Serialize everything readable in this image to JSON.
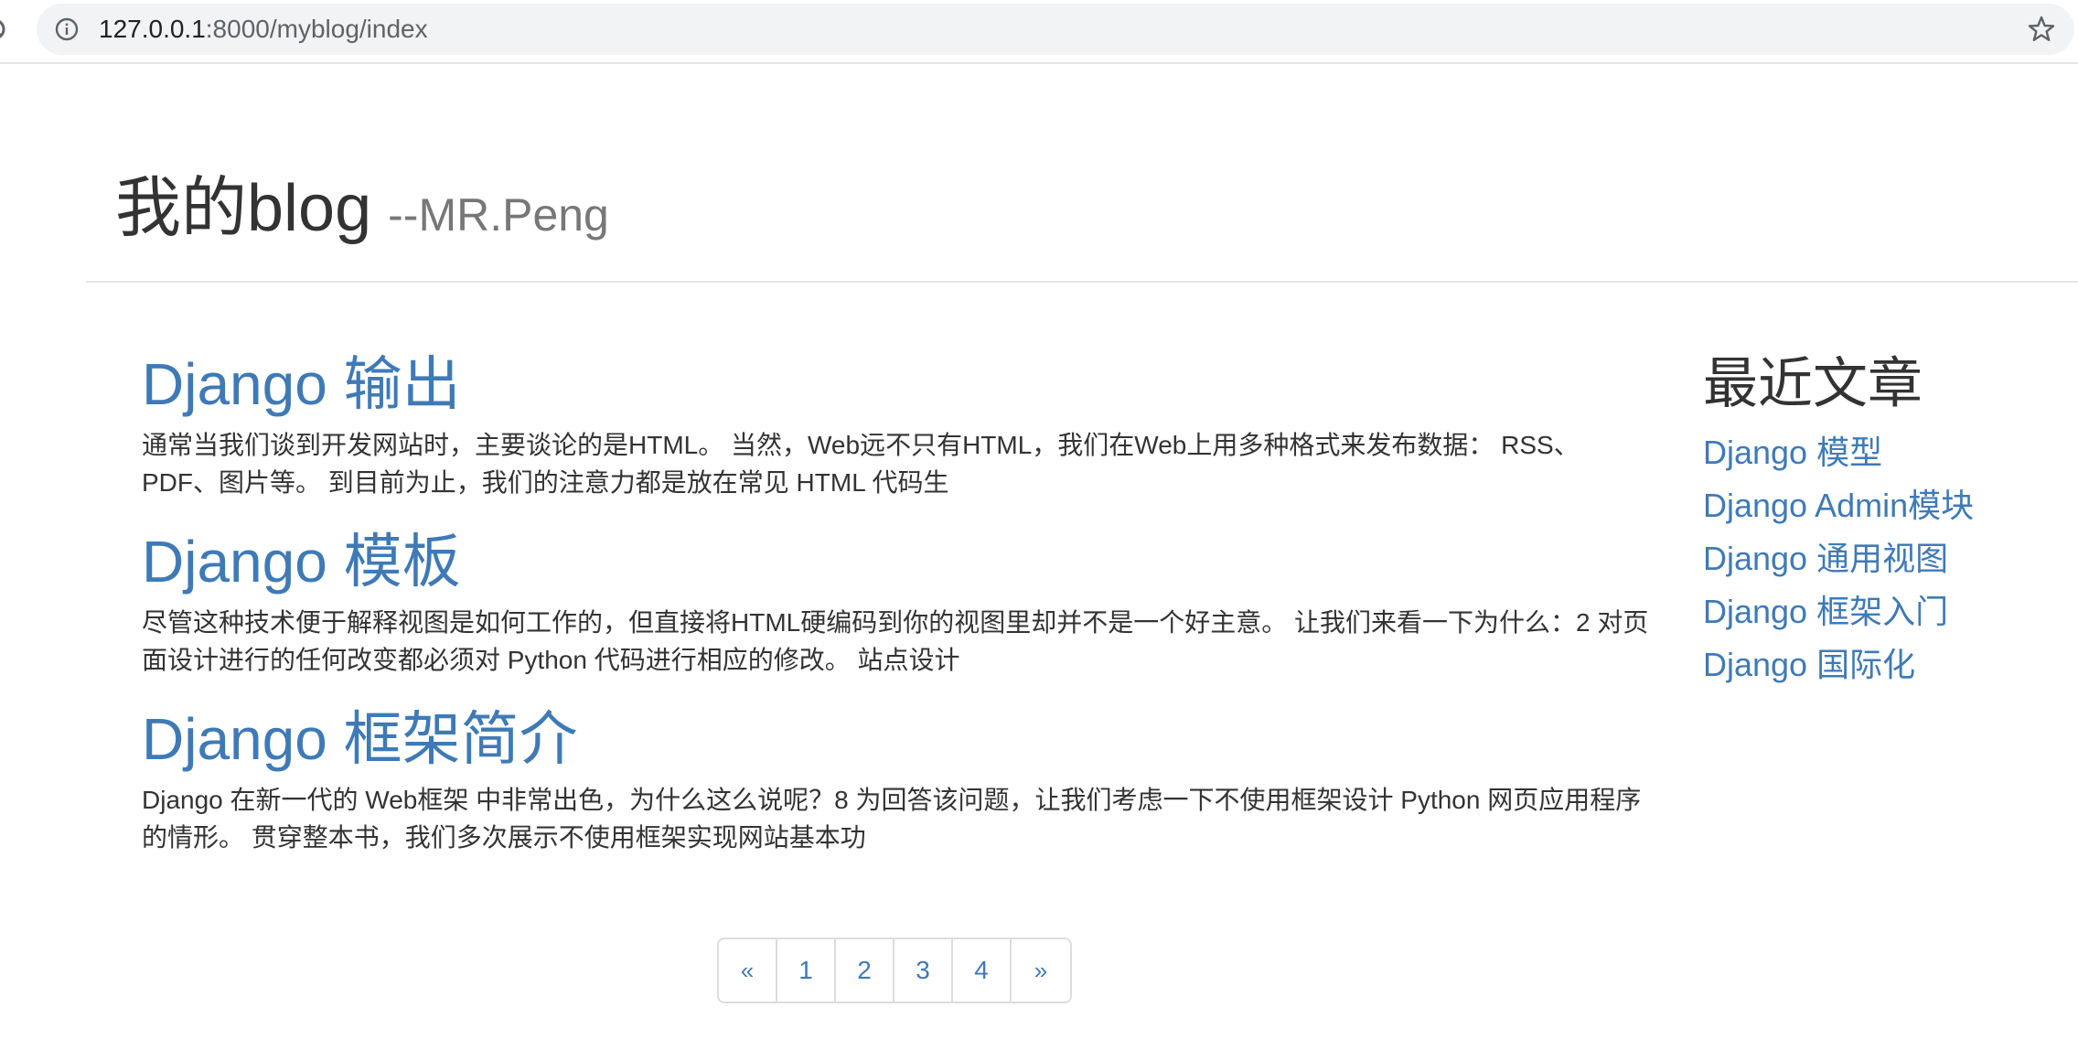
{
  "browser": {
    "url_host": "127.0.0.1",
    "url_rest": ":8000/myblog/index"
  },
  "header": {
    "title": "我的blog",
    "subtitle": "--MR.Peng"
  },
  "posts": [
    {
      "title": "Django 输出",
      "excerpt": "通常当我们谈到开发网站时，主要谈论的是HTML。 当然，Web远不只有HTML，我们在Web上用多种格式来发布数据： RSS、PDF、图片等。 到目前为止，我们的注意力都是放在常见 HTML 代码生"
    },
    {
      "title": "Django 模板",
      "excerpt": "尽管这种技术便于解释视图是如何工作的，但直接将HTML硬编码到你的视图里却并不是一个好主意。 让我们来看一下为什么：2 对页面设计进行的任何改变都必须对 Python 代码进行相应的修改。 站点设计"
    },
    {
      "title": "Django 框架简介",
      "excerpt": "Django 在新一代的 Web框架 中非常出色，为什么这么说呢？8 为回答该问题，让我们考虑一下不使用框架设计 Python 网页应用程序的情形。 贯穿整本书，我们多次展示不使用框架实现网站基本功"
    }
  ],
  "sidebar": {
    "heading": "最近文章",
    "links": [
      "Django 模型",
      "Django Admin模块",
      "Django 通用视图",
      "Django 框架入门",
      "Django 国际化"
    ]
  },
  "pagination": {
    "prev": "«",
    "pages": [
      "1",
      "2",
      "3",
      "4"
    ],
    "next": "»"
  },
  "colors": {
    "link": "#3f7ab7",
    "text": "#333333",
    "muted": "#777777"
  }
}
